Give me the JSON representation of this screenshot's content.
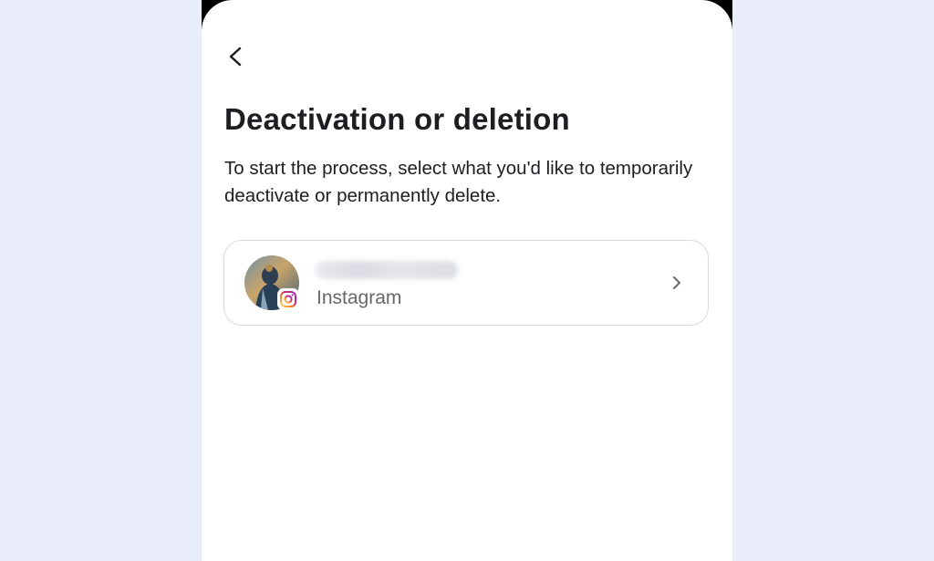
{
  "screen": {
    "title": "Deactivation or deletion",
    "description": "To start the process, select what you'd like to temporarily deactivate or permanently delete."
  },
  "account": {
    "platform": "Instagram"
  },
  "icons": {
    "back": "back-arrow-icon",
    "badge": "instagram-icon",
    "chevron": "chevron-right-icon"
  },
  "colors": {
    "background": "#e8edf9",
    "text_primary": "#1c1e21",
    "text_secondary": "#65676b",
    "card_border": "#d7dbe0",
    "instagram_gradient": [
      "#feda75",
      "#d62976",
      "#962fbf",
      "#4f5bd5"
    ]
  }
}
